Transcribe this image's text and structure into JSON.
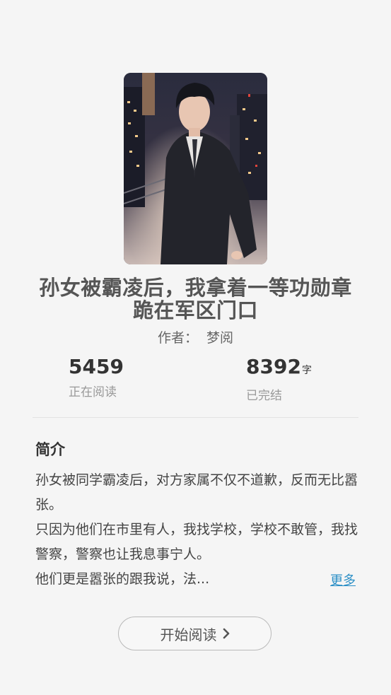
{
  "book": {
    "cover_alt": "cover-illustration",
    "title_line1": "孙女被霸凌后，我拿着一等功勋章",
    "title_line2": "跪在军区门口",
    "author_label": "作者：",
    "author_name": "梦阅"
  },
  "stats": {
    "reading_count": "5459",
    "reading_label": "正在阅读",
    "word_count": "8392",
    "word_unit": "字",
    "status_label": "已完结"
  },
  "intro": {
    "heading": "简介",
    "line1": "孙女被同学霸凌后，对方家属不仅不道歉，反而无比嚣张。",
    "line2": "只因为他们在市里有人，我找学校，学校不敢管，我找警察，警察也让我息事宁人。",
    "line3": "他们更是嚣张的跟我说，法...",
    "more_label": "更多"
  },
  "actions": {
    "start_label": "开始阅读",
    "start_icon": "chevron-right-icon"
  },
  "colors": {
    "background": "#f5f5f5",
    "link": "#2b8fc6",
    "title": "#555555"
  }
}
